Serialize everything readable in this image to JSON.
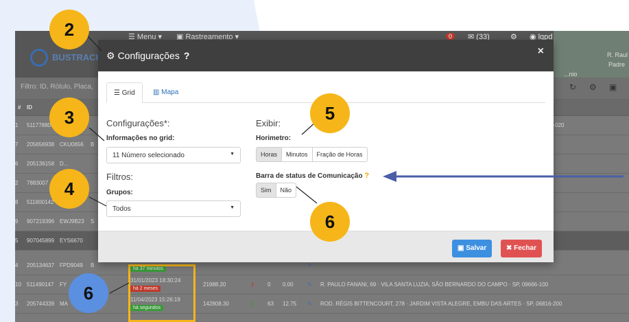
{
  "app": {
    "logo_text": "BUSTRACK",
    "menu_label": "Menu",
    "tracking_label": "Rastreamento",
    "alerts_count": "(33)",
    "user_label": "lgpd",
    "filter_placeholder": "Filtro: ID, Rótulo, Placa,",
    "map_labels": [
      "R. Raul",
      "Padre",
      "...nio"
    ],
    "columns": [
      "#",
      "ID"
    ],
    "rows": [
      {
        "n": "1",
        "id": "511778800",
        "plate": "",
        "extra": "",
        "tail": "9-020"
      },
      {
        "n": "7",
        "id": "205656938",
        "plate": "CKU0656",
        "extra": "B",
        "tail": ""
      },
      {
        "n": "6",
        "id": "205136158",
        "plate": "D...",
        "extra": "",
        "tail": ""
      },
      {
        "n": "2",
        "id": "7883007",
        "plate": "",
        "extra": "",
        "tail": ""
      },
      {
        "n": "8",
        "id": "511800142",
        "plate": "",
        "extra": "",
        "tail": ""
      },
      {
        "n": "9",
        "id": "907219396",
        "plate": "EWJ9B23",
        "extra": "S",
        "tail": ""
      },
      {
        "n": "5",
        "id": "907045899",
        "plate": "EYS6670",
        "extra": "",
        "tail": ""
      },
      {
        "n": "4",
        "id": "205134637",
        "plate": "FPD9049",
        "extra": "B",
        "tail": ""
      },
      {
        "n": "10",
        "id": "511490147",
        "plate": "FY",
        "extra": "",
        "tail": "R. PAULO FANANI, 69 · VILA SANTA LUZIA, SÃO BERNARDO DO CAMPO · SP, 09666-100"
      },
      {
        "n": "3",
        "id": "205744339",
        "plate": "MA",
        "extra": "",
        "tail": "ROD. RÉGIS BITTENCOURT, 278 · JARDIM VISTA ALEGRE, EMBU DAS ARTES · SP, 06816-200"
      }
    ],
    "status_cells": [
      {
        "time": "",
        "tag": "há 37 minutos"
      },
      {
        "time": "31/01/2023 18:30:24",
        "tag": "há 2 meses",
        "odo": "21988.20",
        "speed": "0",
        "value": "0.00"
      },
      {
        "time": "11/04/2023 15:26:19",
        "tag": "há segundos",
        "odo": "142808.30",
        "speed": "63",
        "value": "12.75"
      }
    ],
    "colors": {
      "tag_green": "#3a9a3a",
      "tag_red": "#c0392b",
      "highlight": "#f6b619"
    }
  },
  "modal": {
    "title": "Configurações",
    "help": "?",
    "close": "×",
    "tabs": [
      {
        "label": "Grid",
        "icon": "list-icon",
        "active": true
      },
      {
        "label": "Mapa",
        "icon": "map-icon",
        "active": false
      }
    ],
    "config_title": "Configurações*:",
    "grid_info_label": "Informações no grid:",
    "grid_info_value": "11 Número selecionado",
    "filters_title": "Filtros:",
    "groups_label": "Grupos:",
    "groups_value": "Todos",
    "display_title": "Exibir:",
    "hourmeter_label": "Horimetro:",
    "hourmeter_options": [
      "Horas",
      "Minutos",
      "Fração de Horas"
    ],
    "hourmeter_selected": "Horas",
    "status_bar_label": "Barra de status de Comunicação",
    "status_bar_options": [
      "Sim",
      "Não"
    ],
    "status_bar_selected": "Sim",
    "save_label": "Salvar",
    "close_label": "Fechar"
  },
  "callouts": [
    "2",
    "3",
    "4",
    "5",
    "6",
    "6"
  ],
  "colors": {
    "accent": "#f6b619",
    "save": "#3d8fe0",
    "close": "#e05252",
    "arrow": "#4a5fa8"
  }
}
